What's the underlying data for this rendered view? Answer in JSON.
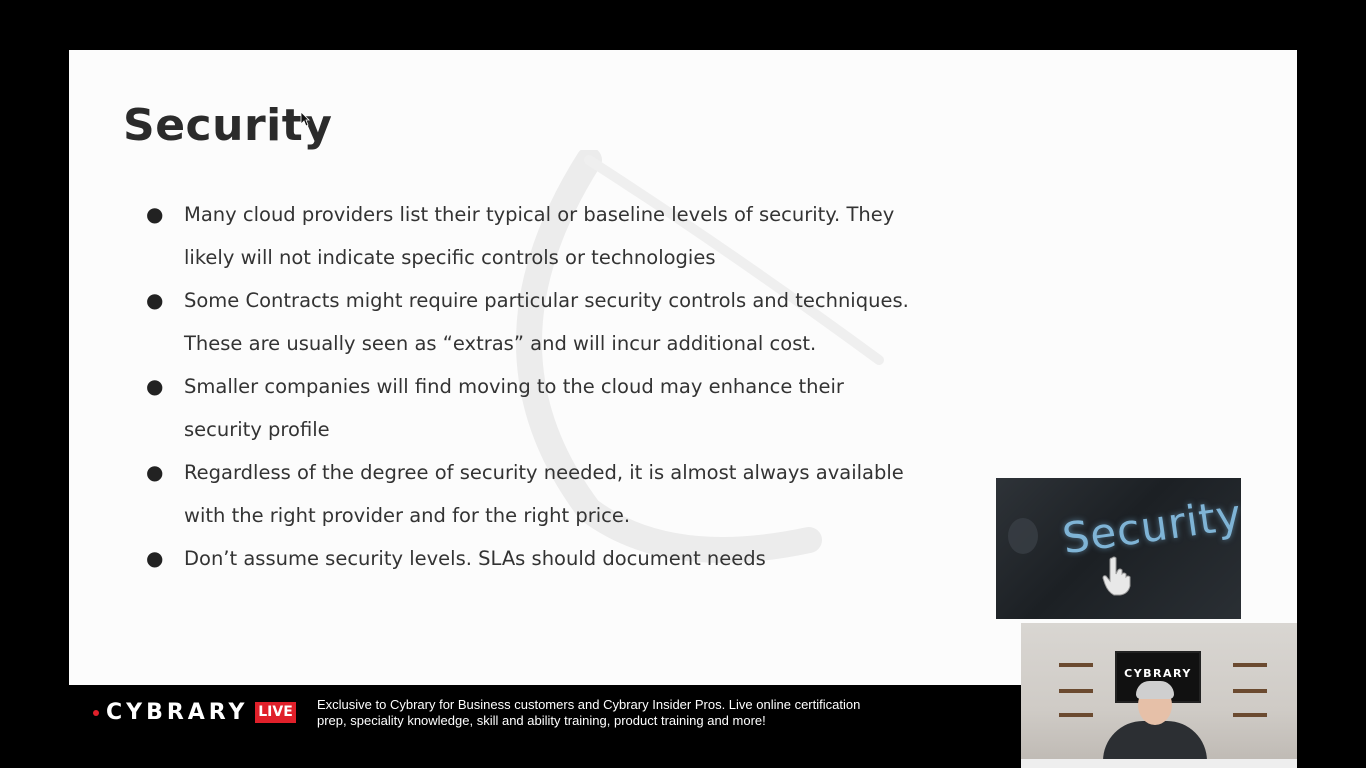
{
  "slide": {
    "title": "Security",
    "bullets": [
      "Many cloud providers list their typical  or baseline levels of security.  They likely will not indicate specific controls or technologies",
      "Some Contracts might require particular security controls and techniques.  These are usually seen as “extras” and will incur additional cost.",
      "Smaller companies will find moving to the cloud may enhance their security profile",
      "Regardless of the degree of security needed, it is almost always available with the right provider and for the right price.",
      "Don’t assume security levels.  SLAs should document needs"
    ],
    "bullet_glyph": "●",
    "image_text": "Security",
    "image_icon": "hand-pointer-icon"
  },
  "bottom_bar": {
    "brand": "CYBRARY",
    "live_badge": "LIVE",
    "promo_line1": "Exclusive to Cybrary for Business customers and Cybrary Insider Pros. Live online certification",
    "promo_line2": "prep, speciality knowledge, skill and ability training, product training and more!"
  },
  "webcam": {
    "tv_text": "CYBRARY"
  },
  "colors": {
    "background": "#000000",
    "slide": "#fcfcfc",
    "text": "#333333",
    "brand_red": "#e0202a"
  }
}
